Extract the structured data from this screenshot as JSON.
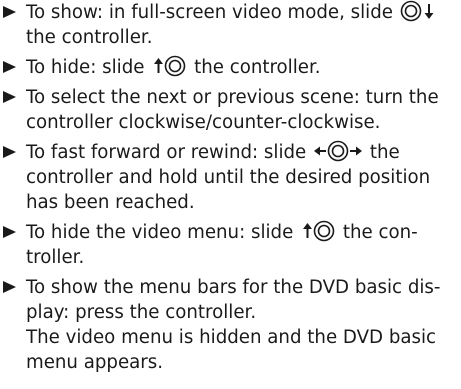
{
  "steps": [
    {
      "line1_a": "To show: in full-screen video mode, slide",
      "line1_icon": "controller-slide-down-icon",
      "line2": "the controller."
    },
    {
      "a": "To hide: slide",
      "icon": "controller-slide-up-icon",
      "b": "the controller."
    },
    {
      "line1": "To select the next or previous scene: turn the",
      "line2": "controller clockwise/counter-clockwise."
    },
    {
      "line1_a": "To fast forward or rewind: slide",
      "line1_icon": "controller-slide-left-right-icon",
      "line1_b": "the",
      "line2": "controller and hold until the desired position",
      "line3": "has been reached."
    },
    {
      "a": "To hide the video menu: slide",
      "icon": "controller-slide-up-icon",
      "b": "the con-",
      "line2": "troller."
    },
    {
      "line1": "To show the menu bars for the DVD basic dis-",
      "line2": "play: press the controller.",
      "line3": "The video menu is hidden and the DVD basic",
      "line4": "menu appears."
    }
  ]
}
